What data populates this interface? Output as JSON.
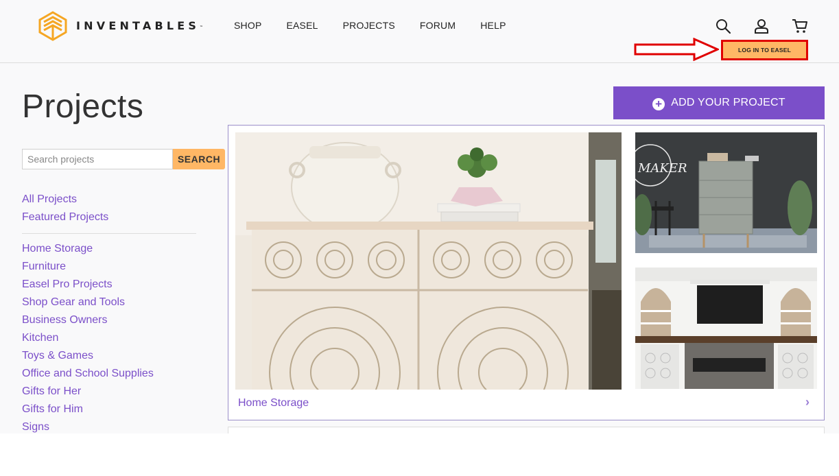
{
  "header": {
    "brand": "INVENTABLES",
    "brand_mark": "™",
    "nav": [
      "SHOP",
      "EASEL",
      "PROJECTS",
      "FORUM",
      "HELP"
    ],
    "icons": [
      "search-icon",
      "account-icon",
      "cart-icon"
    ],
    "login_label": "LOG IN TO EASEL"
  },
  "page": {
    "title": "Projects",
    "add_button": "ADD YOUR PROJECT"
  },
  "search": {
    "placeholder": "Search projects",
    "button": "SEARCH"
  },
  "sidebar": {
    "top_links": [
      "All Projects",
      "Featured Projects"
    ],
    "categories": [
      "Home Storage",
      "Furniture",
      "Easel Pro Projects",
      "Shop Gear and Tools",
      "Business Owners",
      "Kitchen",
      "Toys & Games",
      "Office and School Supplies",
      "Gifts for Her",
      "Gifts for Him",
      "Signs"
    ]
  },
  "featured_card": {
    "category": "Home Storage",
    "chevron": "›",
    "badge_text": "MAKER"
  },
  "colors": {
    "accent": "#7b4fc9",
    "orange": "#ffb765",
    "annotation_red": "#e00000"
  }
}
